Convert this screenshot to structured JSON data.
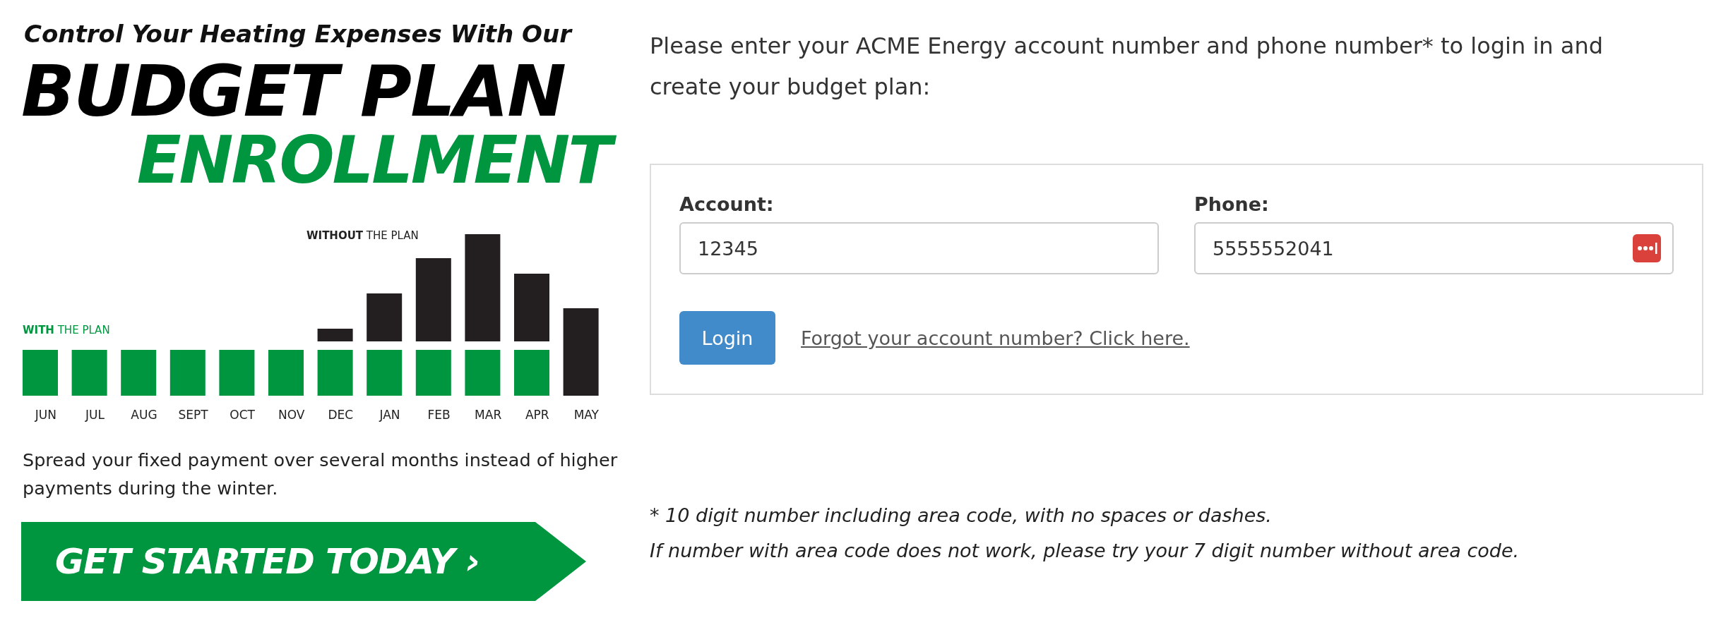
{
  "banner": {
    "tagline": "Control Your Heating Expenses With Our",
    "title": "BUDGET PLAN",
    "subtitle": "ENROLLMENT",
    "legend_without": "**WITHOUT** THE PLAN",
    "legend_with": "**WITH** THE PLAN",
    "months": [
      "JUN",
      "JUL",
      "AUG",
      "SEPT",
      "OCT",
      "NOV",
      "DEC",
      "JAN",
      "FEB",
      "MAR",
      "APR",
      "MAY"
    ],
    "description": "Spread your fixed payment over several months instead of higher payments during the winter.",
    "cta": "GET STARTED TODAY ›"
  },
  "login": {
    "intro": "Please enter your ACME Energy account number and phone number* to login in and create your budget plan:",
    "fields": [
      {
        "kind": "text",
        "label": "Account:",
        "value": "12345"
      },
      {
        "kind": "autofill",
        "label": "Phone:",
        "value": "5555552041"
      }
    ],
    "button": "Login",
    "link": "Forgot your account number? Click here.",
    "notes": [
      "* 10 digit number including area code, with no spaces or dashes.",
      "If number with area code does not work, please try your 7 digit number without area code."
    ]
  }
}
